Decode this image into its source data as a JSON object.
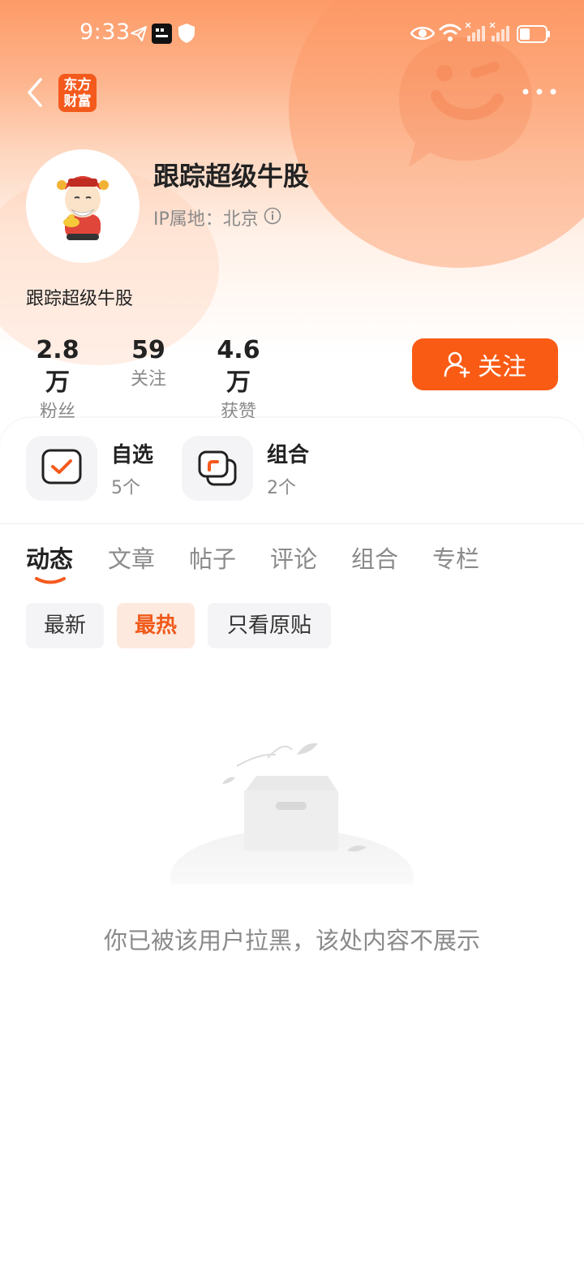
{
  "status_bar": {
    "time": "9:33",
    "icons": [
      "telegram-icon",
      "moji-weather-icon",
      "shield-icon",
      "eye-icon",
      "wifi-icon",
      "signal-icon",
      "signal-icon",
      "battery-icon"
    ]
  },
  "nav": {
    "back_icon": "chevron-left-icon",
    "logo_line1": "东方",
    "logo_line2": "财富",
    "more_icon": "more-dots-icon"
  },
  "profile": {
    "name": "跟踪超级牛股",
    "ip_location": "IP属地：北京",
    "bio": "跟踪超级牛股",
    "stats": [
      {
        "value": "2.8万",
        "label": "粉丝"
      },
      {
        "value": "59",
        "label": "关注"
      },
      {
        "value": "4.6万",
        "label": "获赞"
      }
    ],
    "follow_label": "关注"
  },
  "tiles": [
    {
      "title": "自选",
      "subtitle": "5个",
      "icon": "checkbox-icon"
    },
    {
      "title": "组合",
      "subtitle": "2个",
      "icon": "overlap-squares-icon"
    }
  ],
  "tabs": [
    "动态",
    "文章",
    "帖子",
    "评论",
    "组合",
    "专栏"
  ],
  "active_tab": "动态",
  "filters": [
    "最新",
    "最热",
    "只看原贴"
  ],
  "active_filter": "最热",
  "empty_message": "你已被该用户拉黑，该处内容不展示",
  "colors": {
    "accent": "#fa5b14",
    "accent_soft": "#fde9de",
    "header_gradient_top": "#fd9a66"
  }
}
